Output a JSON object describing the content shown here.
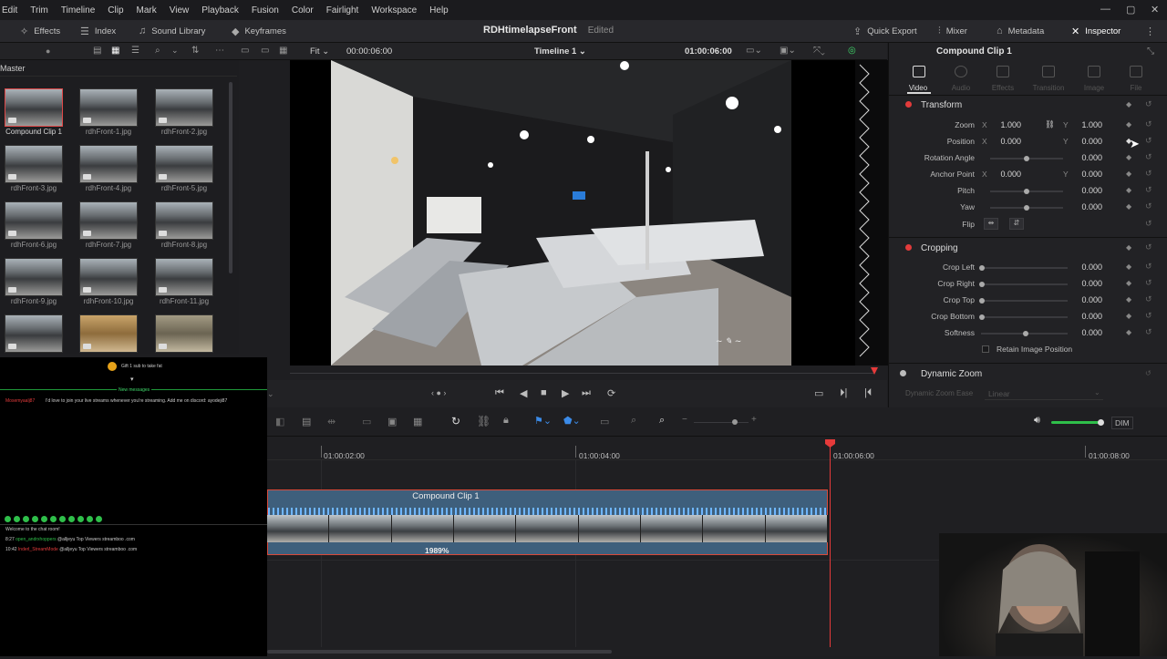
{
  "menu": [
    "Edit",
    "Trim",
    "Timeline",
    "Clip",
    "Mark",
    "View",
    "Playback",
    "Fusion",
    "Color",
    "Fairlight",
    "Workspace",
    "Help"
  ],
  "toolbar": {
    "effects": "Effects",
    "index": "Index",
    "sound_library": "Sound Library",
    "keyframes": "Keyframes",
    "project_title": "RDHtimelapseFront",
    "project_status": "Edited",
    "quick_export": "Quick Export",
    "mixer": "Mixer",
    "metadata": "Metadata",
    "inspector": "Inspector"
  },
  "viewer": {
    "fit": "Fit",
    "src_timecode": "00:00:06:00",
    "timeline_name": "Timeline 1",
    "rec_timecode": "01:00:06:00"
  },
  "media_pool": {
    "title": "Master",
    "clips": [
      "Compound Clip 1",
      "rdhFront-1.jpg",
      "rdhFront-2.jpg",
      "rdhFront-3.jpg",
      "rdhFront-4.jpg",
      "rdhFront-5.jpg",
      "rdhFront-6.jpg",
      "rdhFront-7.jpg",
      "rdhFront-8.jpg",
      "rdhFront-9.jpg",
      "rdhFront-10.jpg",
      "rdhFront-11.jpg"
    ]
  },
  "chat": {
    "banner": "Gift 1 sub to take fat",
    "new_messages": "New messages",
    "msg1_user": "Mosemyaalj87",
    "msg1_text": "I'd love to join your live streams whenever you're streaming. Add me on discord: ayodeji87",
    "welcome": "Welcome to the chat room!",
    "row1_time": "8:27",
    "row1_user": "open_andrxhoppers",
    "row1_text": "@alljeyu Top Viewers streamboo .com",
    "row2_time": "10:42",
    "row2_user": "Inderl_StreamMode",
    "row2_text": "@alljeyu Top Viewers streamboo .com"
  },
  "inspector": {
    "clip_name": "Compound Clip 1",
    "tabs": [
      "Video",
      "Audio",
      "Effects",
      "Transition",
      "Image",
      "File"
    ],
    "transform": {
      "title": "Transform",
      "zoom_label": "Zoom",
      "zoom_x": "1.000",
      "zoom_y": "1.000",
      "position_label": "Position",
      "pos_x": "0.000",
      "pos_y": "0.000",
      "rotation_label": "Rotation Angle",
      "rotation": "0.000",
      "anchor_label": "Anchor Point",
      "anchor_x": "0.000",
      "anchor_y": "0.000",
      "pitch_label": "Pitch",
      "pitch": "0.000",
      "yaw_label": "Yaw",
      "yaw": "0.000",
      "flip_label": "Flip"
    },
    "cropping": {
      "title": "Cropping",
      "left_label": "Crop Left",
      "left": "0.000",
      "right_label": "Crop Right",
      "right": "0.000",
      "top_label": "Crop Top",
      "top": "0.000",
      "bottom_label": "Crop Bottom",
      "bottom": "0.000",
      "soft_label": "Softness",
      "soft": "0.000",
      "retain": "Retain Image Position"
    },
    "dynamic_zoom": {
      "title": "Dynamic Zoom",
      "ease_label": "Dynamic Zoom Ease",
      "ease_value": "Linear"
    }
  },
  "timeline": {
    "dim": "DIM",
    "tc1": "01:00:02:00",
    "tc2": "01:00:04:00",
    "tc3": "01:00:06:00",
    "tc4": "01:00:08:00",
    "clip_title": "Compound Clip 1",
    "speed": "1989%"
  }
}
